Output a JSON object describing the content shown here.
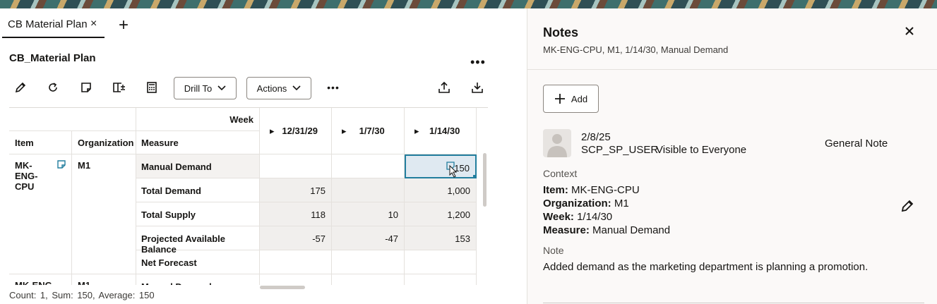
{
  "tab": {
    "label": "CB Material Plan",
    "close": "×",
    "add": "+"
  },
  "page": {
    "title": "CB_Material Plan",
    "more": "•••"
  },
  "toolbar": {
    "drill_to": "Drill To",
    "actions": "Actions",
    "more": "•••"
  },
  "grid": {
    "week_label": "Week",
    "headers": {
      "item": "Item",
      "organization": "Organization",
      "measure": "Measure"
    },
    "columns": [
      "12/31/29",
      "1/7/30",
      "1/14/30"
    ],
    "rows": [
      {
        "item": "MK-ENG-CPU",
        "org": "M1",
        "measure": "Manual Demand",
        "values": [
          "",
          "",
          "150"
        ]
      },
      {
        "item": "",
        "org": "",
        "measure": "Total Demand",
        "values": [
          "175",
          "",
          "1,000"
        ]
      },
      {
        "item": "",
        "org": "",
        "measure": "Total Supply",
        "values": [
          "118",
          "10",
          "1,200"
        ]
      },
      {
        "item": "",
        "org": "",
        "measure": "Projected Available Balance",
        "values": [
          "-57",
          "-47",
          "153"
        ]
      },
      {
        "item": "",
        "org": "",
        "measure": "Net Forecast",
        "values": [
          "",
          "",
          ""
        ]
      },
      {
        "item": "MK-ENG",
        "org": "M1",
        "measure": "Manual Demand",
        "values": [
          "",
          "",
          ""
        ]
      }
    ]
  },
  "status": {
    "text": "Count: 1,   Sum: 150,   Average: 150"
  },
  "notes": {
    "title": "Notes",
    "subtitle": "MK-ENG-CPU, M1, 1/14/30, Manual Demand",
    "add_label": "Add",
    "entry": {
      "date": "2/8/25",
      "user": "SCP_SP_USER",
      "visibility": "Visible to Everyone",
      "type": "General Note",
      "context_label": "Context",
      "item_key": "Item:",
      "item_val": "MK-ENG-CPU",
      "org_key": "Organization:",
      "org_val": "M1",
      "week_key": "Week:",
      "week_val": "1/14/30",
      "measure_key": "Measure:",
      "measure_val": "Manual Demand",
      "note_label": "Note",
      "note_text": "Added demand as the marketing department is planning a promotion."
    }
  },
  "colors": {
    "accent": "#227e9e",
    "selected_cell": "#dfe9f1",
    "shade": "#f1efed"
  }
}
